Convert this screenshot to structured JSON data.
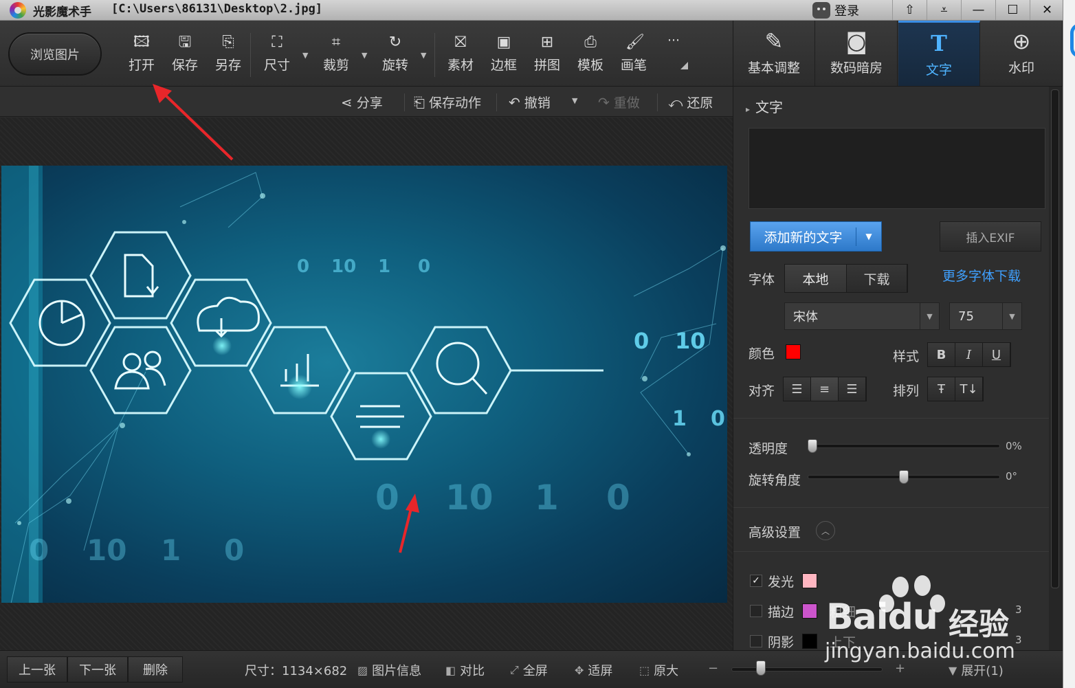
{
  "window": {
    "app_title": "光影魔术手",
    "file_path": "[C:\\Users\\86131\\Desktop\\2.jpg]",
    "login_label": "登录",
    "controls": [
      "⇧",
      "⩡",
      "—",
      "☐",
      "✕"
    ]
  },
  "toolbar": {
    "browse_label": "浏览图片",
    "items": [
      {
        "label": "打开",
        "icon": "open-image-icon"
      },
      {
        "label": "保存",
        "icon": "save-icon"
      },
      {
        "label": "另存",
        "icon": "save-as-icon"
      },
      {
        "label": "尺寸",
        "icon": "resize-icon"
      },
      {
        "label": "裁剪",
        "icon": "crop-icon"
      },
      {
        "label": "旋转",
        "icon": "rotate-icon"
      },
      {
        "label": "素材",
        "icon": "material-icon"
      },
      {
        "label": "边框",
        "icon": "frame-icon"
      },
      {
        "label": "拼图",
        "icon": "collage-icon"
      },
      {
        "label": "模板",
        "icon": "template-icon"
      },
      {
        "label": "画笔",
        "icon": "brush-icon"
      }
    ],
    "more_label": "···"
  },
  "subbar": {
    "share": "分享",
    "save_action": "保存动作",
    "undo": "撤销",
    "redo": "重做",
    "restore": "还原"
  },
  "right_tabs": [
    {
      "label": "基本调整",
      "icon": "basic-adjust-icon"
    },
    {
      "label": "数码暗房",
      "icon": "darkroom-icon"
    },
    {
      "label": "文字",
      "icon": "text-icon",
      "active": true
    },
    {
      "label": "水印",
      "icon": "watermark-icon"
    }
  ],
  "panel": {
    "section_title": "文字",
    "add_text_label": "添加新的文字",
    "insert_exif_label": "插入EXIF",
    "font_label": "字体",
    "font_tabs": [
      "本地",
      "下载"
    ],
    "more_fonts_link": "更多字体下载",
    "font_name": "宋体",
    "font_size": "75",
    "color_label": "颜色",
    "text_color": "#ff0000",
    "style_label": "样式",
    "style_buttons": [
      "B",
      "I",
      "U"
    ],
    "align_label": "对齐",
    "arrange_label": "排列",
    "opacity_label": "透明度",
    "opacity_value": "0%",
    "opacity_fraction": 0,
    "rotation_label": "旋转角度",
    "rotation_value": "0°",
    "rotation_fraction": 0.5,
    "advanced_label": "高级设置",
    "glow_label": "发光",
    "glow_color": "#ffb6c1",
    "glow_checked": true,
    "stroke_label": "描边",
    "stroke_color": "#cc55cc",
    "stroke_extra": "粗细",
    "stroke_value": "3",
    "shadow_label": "阴影",
    "shadow_color": "#000000",
    "shadow_extra": "上下",
    "shadow_value": "3"
  },
  "statusbar": {
    "prev": "上一张",
    "next": "下一张",
    "delete": "删除",
    "size_text": "尺寸：1134×682",
    "info": "图片信息",
    "compare": "对比",
    "fullscreen": "全屏",
    "fit": "适屏",
    "original": "原大",
    "expand": "展开(1)"
  },
  "watermark": {
    "brand": "Bai",
    "brand2": "du",
    "cn": "经验",
    "url": "jingyan.baidu.com"
  },
  "photo_digits": [
    "0",
    "10",
    "1",
    "0",
    "0",
    "10",
    "1",
    "0",
    "0",
    "10",
    "1",
    "0",
    "0",
    "10",
    "1",
    "0"
  ]
}
